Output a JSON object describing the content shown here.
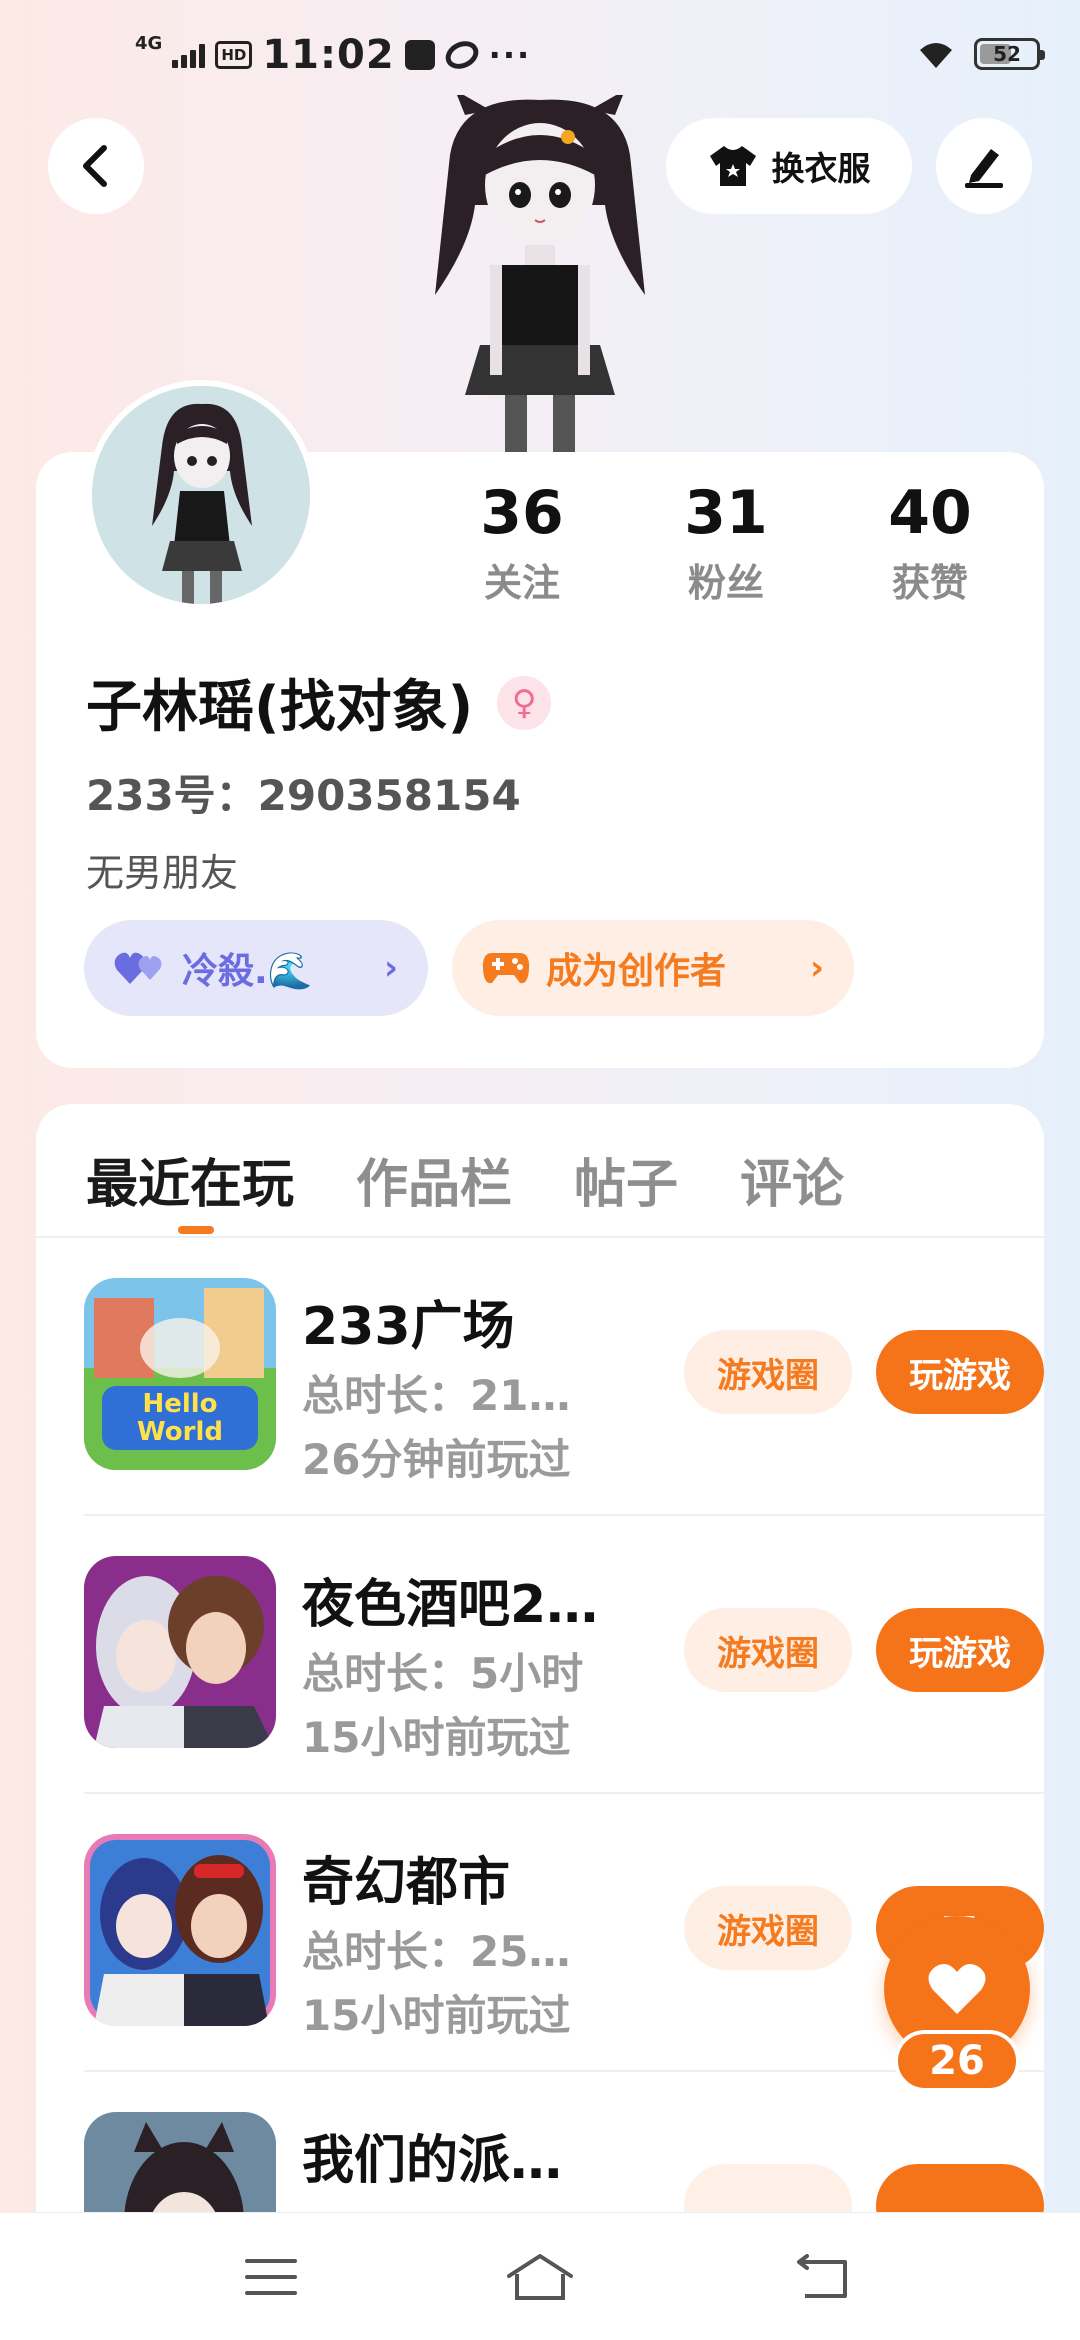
{
  "status_bar": {
    "network": "4G",
    "hd": "HD",
    "time": "11:02",
    "dots": "···",
    "battery": "52"
  },
  "header": {
    "dress_label": "换衣服"
  },
  "profile": {
    "stats": [
      {
        "num": "36",
        "label": "关注"
      },
      {
        "num": "31",
        "label": "粉丝"
      },
      {
        "num": "40",
        "label": "获赞"
      }
    ],
    "username": "子林瑶(找对象)",
    "gender_symbol": "♀",
    "uid": "233号：290358154",
    "bio": "无男朋友",
    "friend_pill": "冷殺.🌊",
    "creator_pill": "成为创作者"
  },
  "tabs": [
    "最近在玩",
    "作品栏",
    "帖子",
    "评论"
  ],
  "games": [
    {
      "name": "233广场",
      "duration": "总时长：21…",
      "last_played": "26分钟前玩过",
      "circle_label": "游戏圈",
      "play_label": "玩游戏"
    },
    {
      "name": "夜色酒吧2…",
      "duration": "总时长：5小时",
      "last_played": "15小时前玩过",
      "circle_label": "游戏圈",
      "play_label": "玩游戏"
    },
    {
      "name": "奇幻都市",
      "duration": "总时长：25…",
      "last_played": "15小时前玩过",
      "circle_label": "游戏圈",
      "play_label": "玩"
    },
    {
      "name": "我们的派…",
      "duration": "",
      "last_played": "",
      "circle_label": "",
      "play_label": ""
    }
  ],
  "like_fab": {
    "count": "26"
  },
  "colors": {
    "accent": "#f5741a",
    "lavender": "#6a6ce0"
  },
  "icons": [
    "back-arrow-icon",
    "tshirt-icon",
    "pen-icon",
    "heart-icon",
    "gamepad-icon",
    "menu-icon",
    "home-icon",
    "return-icon"
  ]
}
